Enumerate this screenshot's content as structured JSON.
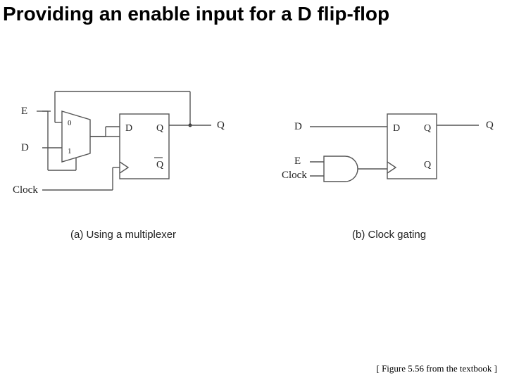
{
  "title": "Providing an enable input for a D flip-flop",
  "fig_a": {
    "inputs": {
      "E": "E",
      "D": "D",
      "Clock": "Clock"
    },
    "mux": {
      "sel0": "0",
      "sel1": "1"
    },
    "ff": {
      "D": "D",
      "Q": "Q",
      "Qbar": "Q"
    },
    "out": "Q",
    "caption": "(a) Using a multiplexer"
  },
  "fig_b": {
    "inputs": {
      "D": "D",
      "E": "E",
      "Clock": "Clock"
    },
    "ff": {
      "D": "D",
      "Q": "Q",
      "Qb": "Q"
    },
    "out": "Q",
    "caption": "(b) Clock gating"
  },
  "footnote": "[ Figure 5.56 from the textbook ]"
}
